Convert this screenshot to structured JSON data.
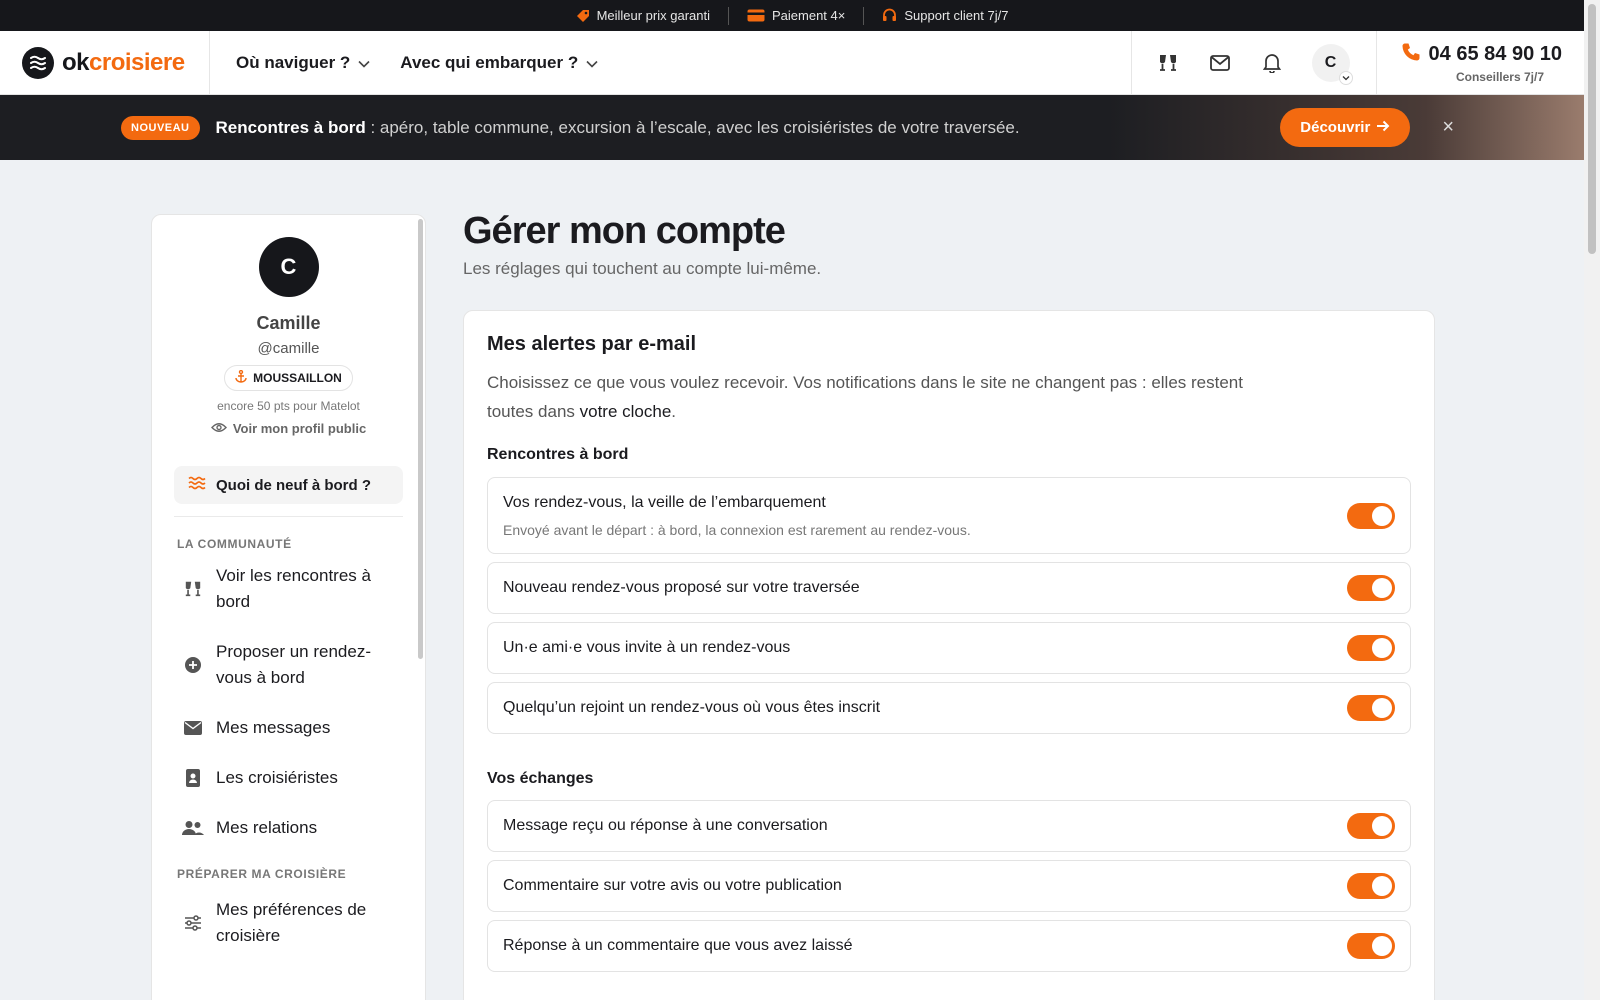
{
  "topstrip": [
    {
      "icon": "tag-icon",
      "label": "Meilleur prix garanti"
    },
    {
      "icon": "card-icon",
      "label": "Paiement 4×"
    },
    {
      "icon": "headset-icon",
      "label": "Support client 7j/7"
    }
  ],
  "header": {
    "brand_ok": "ok",
    "brand_rest": "croisiere",
    "nav": [
      "Où naviguer ?",
      "Avec qui embarquer ?"
    ],
    "avatar_initial": "C",
    "phone": "04 65 84 90 10",
    "phone_sub": "Conseillers 7j/7"
  },
  "banner": {
    "badge": "NOUVEAU",
    "title": "Rencontres à bord",
    "text": " : apéro, table commune, excursion à l’escale, avec les croisiéristes de votre traversée.",
    "button": "Découvrir",
    "close": "×"
  },
  "sidebar": {
    "initial": "C",
    "name": "Camille",
    "handle": "@camille",
    "rank": "MOUSSAILLON",
    "rank_sub": "encore 50 pts pour Matelot",
    "public_profile": "Voir mon profil public",
    "news_button": "Quoi de neuf à bord ?",
    "section_community": "LA COMMUNAUTÉ",
    "community_items": [
      "Voir les rencontres à bord",
      "Proposer un rendez-vous à bord",
      "Mes messages",
      "Les croisiéristes",
      "Mes relations"
    ],
    "section_prepare": "PRÉPARER MA CROISIÈRE",
    "prepare_items": [
      "Mes préférences de croisière"
    ]
  },
  "main": {
    "title": "Gérer mon compte",
    "subtitle": "Les réglages qui touchent au compte lui-même.",
    "card_title": "Mes alertes par e-mail",
    "card_desc_1": "Choisissez ce que vous voulez recevoir. Vos notifications dans le site ne changent pas : elles restent toutes dans ",
    "card_desc_link": "votre cloche",
    "card_desc_2": ".",
    "group1": "Rencontres à bord",
    "group1_rows": [
      {
        "label": "Vos rendez-vous, la veille de l’embarquement",
        "sub": "Envoyé avant le départ : à bord, la connexion est rarement au rendez-vous.",
        "on": true
      },
      {
        "label": "Nouveau rendez-vous proposé sur votre traversée",
        "on": true
      },
      {
        "label": "Un·e ami·e vous invite à un rendez-vous",
        "on": true
      },
      {
        "label": "Quelqu’un rejoint un rendez-vous où vous êtes inscrit",
        "on": true
      }
    ],
    "group2": "Vos échanges",
    "group2_rows": [
      {
        "label": "Message reçu ou réponse à une conversation",
        "on": true
      },
      {
        "label": "Commentaire sur votre avis ou votre publication",
        "on": true
      },
      {
        "label": "Réponse à un commentaire que vous avez laissé",
        "on": true
      }
    ]
  },
  "colors": {
    "accent": "#f36a10",
    "dark": "#16171b"
  }
}
